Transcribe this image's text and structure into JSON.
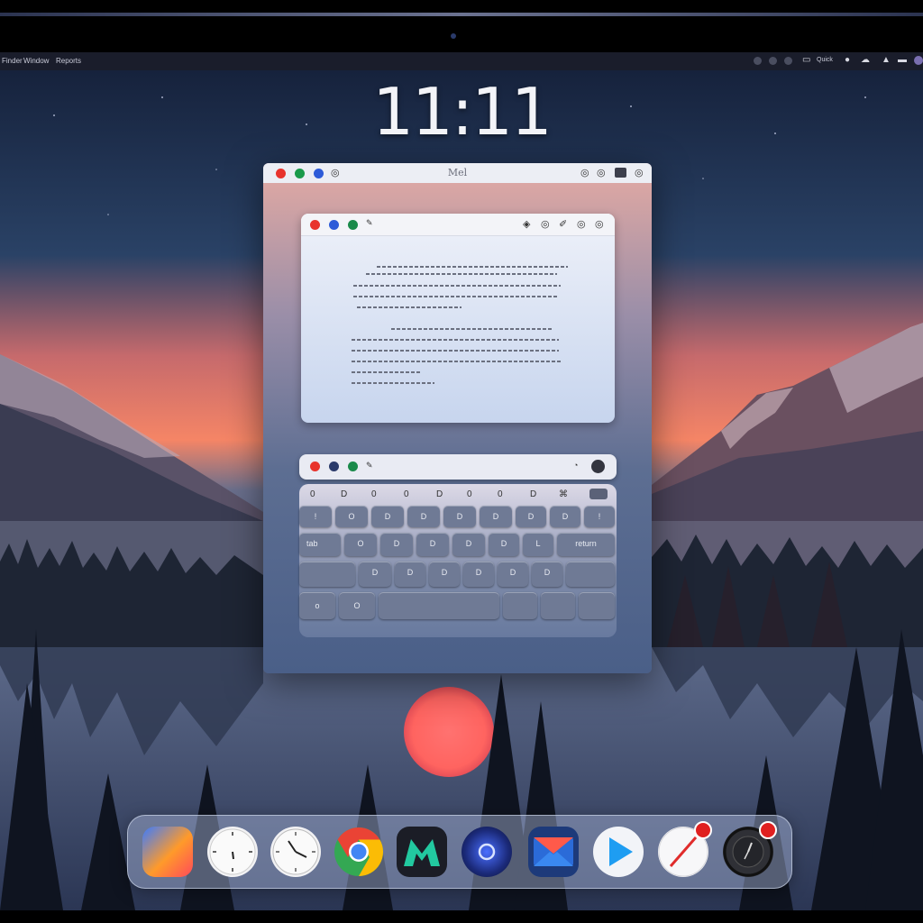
{
  "clock": {
    "time": "11:11"
  },
  "menubar": {
    "left_items": [
      "Finder",
      "Window",
      "Reports"
    ],
    "right_icons": [
      "status-dot",
      "status-dot",
      "status-dot",
      "control-center-icon",
      "search-icon",
      "wifi-icon",
      "cloud-icon",
      "battery-icon",
      "user-avatar"
    ],
    "right_label": "Quick"
  },
  "outer_window": {
    "title": "Mel",
    "traffic_lights": [
      "#e8332c",
      "#1a9a4a",
      "#2d5bd8"
    ]
  },
  "document_window": {
    "tab_label": "",
    "traffic_lights": [
      "#e8332c",
      "#2d5bd8",
      "#1a8a4a"
    ],
    "toolbar_icons": [
      "eye-icon",
      "share-icon",
      "pen-icon",
      "info-icon"
    ]
  },
  "keyboard": {
    "function_row": [
      "0",
      "D",
      "0",
      "0",
      "D",
      "0",
      "0",
      "D",
      "⌘"
    ],
    "rows": [
      [
        "!",
        "O",
        "D",
        "D",
        "D",
        "D",
        "D",
        "D",
        "!"
      ],
      [
        "tab",
        "O",
        "D",
        "D",
        "D",
        "D",
        "L",
        "D",
        "return"
      ],
      [
        "",
        "D",
        "D",
        "D",
        "D",
        "D",
        "D",
        ""
      ],
      [
        "o",
        "O",
        "",
        "",
        "",
        ""
      ]
    ]
  },
  "dock": {
    "apps": [
      {
        "name": "launcher",
        "icon": "launcher-icon"
      },
      {
        "name": "clock",
        "icon": "clock-icon"
      },
      {
        "name": "clock-2",
        "icon": "clock-icon"
      },
      {
        "name": "chrome",
        "icon": "chrome-icon"
      },
      {
        "name": "maps",
        "icon": "maps-icon"
      },
      {
        "name": "siri",
        "icon": "siri-icon"
      },
      {
        "name": "mail",
        "icon": "mail-icon"
      },
      {
        "name": "play",
        "icon": "play-icon"
      },
      {
        "name": "safari",
        "icon": "safari-icon",
        "badge": ""
      },
      {
        "name": "dark-clock",
        "icon": "clock-icon",
        "badge": ""
      }
    ]
  },
  "colors": {
    "close": "#e8332c",
    "sky_top": "#1a2540",
    "sunset": "#f37a62",
    "sun": "#ff6e6a"
  }
}
